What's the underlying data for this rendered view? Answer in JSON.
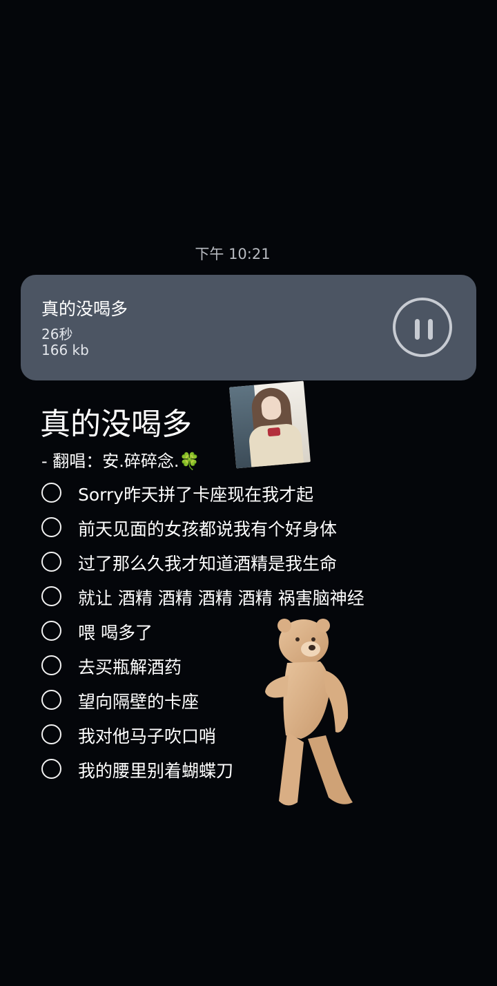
{
  "timestamp": "下午 10:21",
  "voice_message": {
    "title": "真的没喝多",
    "duration": "26秒",
    "size": "166 kb",
    "control_icon": "pause-icon"
  },
  "song": {
    "title": "真的没喝多",
    "artist_line": "-  翻唱：安.碎碎念.",
    "artist_emoji": "🍀"
  },
  "lyrics": [
    {
      "text": "Sorry昨天拼了卡座现在我才起",
      "checked": false
    },
    {
      "text": "前天见面的女孩都说我有个好身体",
      "checked": false
    },
    {
      "text": "过了那么久我才知道酒精是我生命",
      "checked": false
    },
    {
      "text": "就让 酒精 酒精 酒精 酒精 祸害脑神经",
      "checked": false
    },
    {
      "text": "喂 喝多了",
      "checked": false
    },
    {
      "text": "去买瓶解酒药",
      "checked": false
    },
    {
      "text": "望向隔壁的卡座",
      "checked": false
    },
    {
      "text": "我对他马子吹口哨",
      "checked": false
    },
    {
      "text": "我的腰里别着蝴蝶刀",
      "checked": false
    }
  ],
  "colors": {
    "background": "#04060a",
    "card": "#4c5563",
    "checkbox": "#f2f2f2"
  }
}
